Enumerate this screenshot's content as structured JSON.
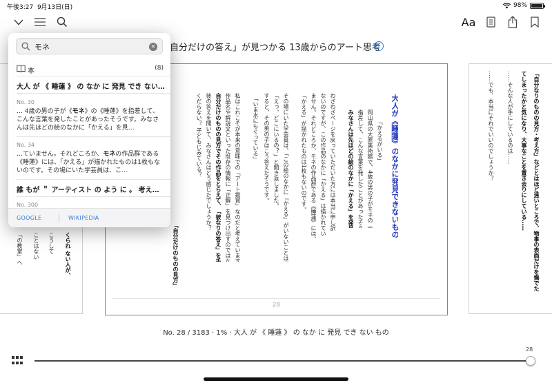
{
  "status_bar": {
    "time": "午後3:27",
    "date": "9月13日(日)",
    "battery_percent": "98%",
    "battery_level": 0.98
  },
  "toolbar": {
    "font_button": "Aa",
    "icons": [
      "chevron-down-icon",
      "menu-icon",
      "search-icon",
      "document-icon",
      "share-icon",
      "bookmark-icon"
    ]
  },
  "book": {
    "title": "自分だけの答え」が見つかる 13歳からのアート思考"
  },
  "search": {
    "query": "モネ",
    "results_label": "本",
    "results_count": "(8)",
    "results": [
      {
        "title": "大人 が 《 睡蓮 》 の なか に 発見 でき ない…",
        "location": "No. 30",
        "snippet": "… 4歳の男の子が《モネ》の《睡蓮》を指差して、こんな言葉を発したことがあったそうです。みなさんは先ほどの絵のなかに「かえる」を見…"
      },
      {
        "title": "",
        "location": "No. 34",
        "snippet": "…ていません。それどころか、モネの作品群である《睡蓮》には、「かえる」が描かれたものは1枚もないのです。その場にいた学芸員は、こ…"
      },
      {
        "title": "誰 もが ＂ アーティスト の よう に 。 考え…",
        "location": "No. 300",
        "snippet": ""
      }
    ],
    "footer_links": [
      "GOOGLE",
      "WIKIPEDIA"
    ]
  },
  "page_center": {
    "page_number": "28",
    "heading_highlight": "睡蓮",
    "heading_pre": "大人が《",
    "heading_post": "》のなかに発見できないもの",
    "col_1": "「かえるがいる」",
    "col_2": "岡山県の大原美術館で、4歳の男の子がモネの《睡蓮》を",
    "col_3": "指差して、こんな言葉を発したことがあったそうです。",
    "col_4": "みなさんは先ほどの絵のなかに「かえる」を発見できましたか？",
    "col_5": "わざわざページを戻っていただいた方には本当に申し訳",
    "col_6": "ないのですが、この作品のなかに「かえる」は描かれてい",
    "col_7": "ません。それどころか、モネの作品群である《睡蓮》には、",
    "col_8": "「かえる」が描かれたものは1枚もないのです。",
    "col_9": "その場にいた学芸員は、「この絵のなかに『かえる』がいないことは当然知っていましたが、",
    "col_10": "「えっ、どこにいるの？」と聞き返しました。",
    "col_11": "すると、その男の子はこう答えたそうです。",
    "col_12": "「いま水にもぐっている」",
    "col_13": "私はこれこそが本来の意味での「アート鑑賞」なのだと考えています。",
    "col_14": "作品名や解説文といった既存の情報に「正解」を見つけ出すのではなく、",
    "col_15": "自分だけのものの見方でその作品をとらえて、「彼なりの答え」を手に入れています。",
    "col_16": "彼の答えを聞いて、みなさんはどう感じたでしょうか？",
    "col_17": "「自分だけのものの見方」",
    "col_18": "くだらない？ 子どもじみている？"
  },
  "page_left": {
    "col_1": "くられ ない人が、",
    "col_2": "激動",
    "col_3": "こうして",
    "col_4": "ことはない",
    "col_5": "「の教室」へ"
  },
  "page_right": {
    "col_1": "「自分なりのものの見方・考え方」などとはほど遠いところで、物事の表面だけを撫でたようなものに",
    "col_2": "てしまったかと気になり、大事なことを置き去りにしている……",
    "col_3": "……そんな人が手にしているのは……",
    "col_4": "……でも、本当にそれでいいのでしょうか？"
  },
  "location_bar": {
    "text": "No. 28 / 3183 · 1% · 大人 が 《 睡蓮 》 の なか に 発見 でき ない もの",
    "progress_page": "28",
    "progress_fraction": 0.99
  }
}
